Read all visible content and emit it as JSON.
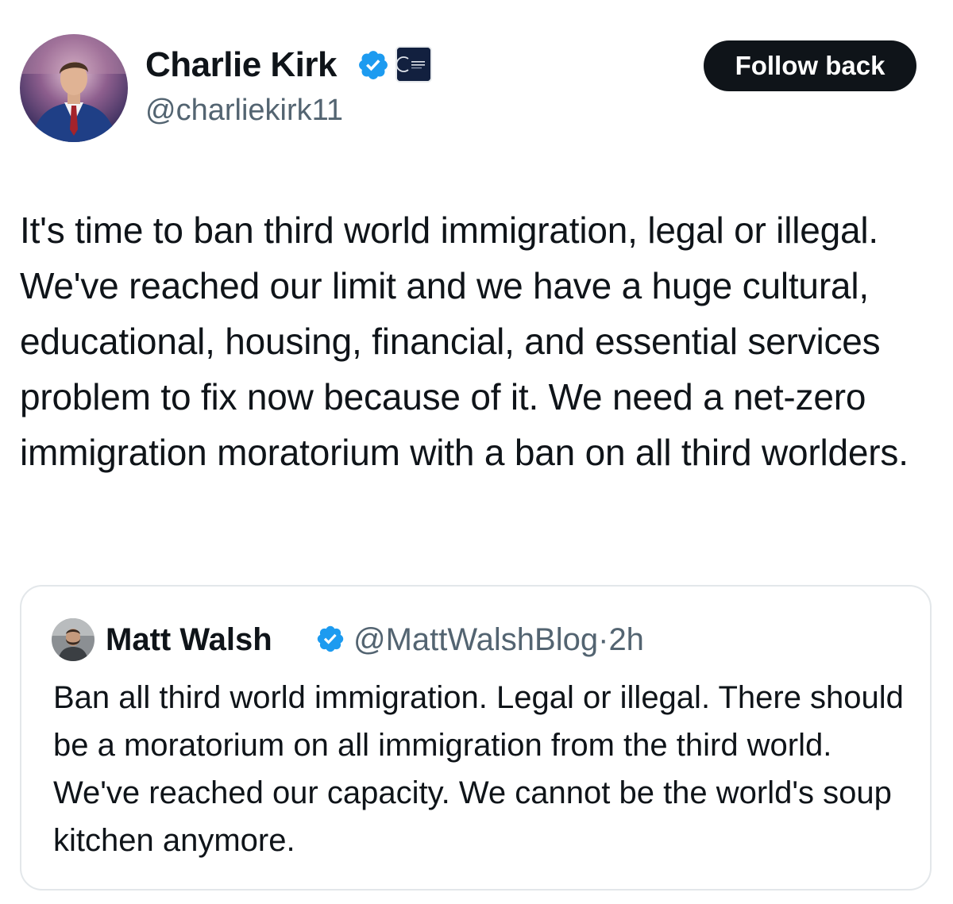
{
  "tweet": {
    "author": {
      "display_name": "Charlie Kirk",
      "handle": "@charliekirk11",
      "verified": true,
      "avatar": "profile-photo",
      "affiliation_badge": "turning-point-usa-logo"
    },
    "follow_button_label": "Follow back",
    "text": "It's time to ban third world immigration, legal or illegal. We've reached our limit and we have a huge cultural, educational, housing, financial, and essential services problem to fix now because of it. We need a net-zero immigration moratorium with a ban on all third worlders."
  },
  "quoted_tweet": {
    "author": {
      "display_name": "Matt Walsh",
      "handle": "@MattWalshBlog",
      "verified": true,
      "avatar": "profile-photo"
    },
    "separator": "·",
    "time": "2h",
    "text": "Ban all third world immigration. Legal or illegal. There should be a moratorium on all immigration from the third world. We've reached our capacity. We cannot be the world's soup kitchen anymore."
  },
  "colors": {
    "text_primary": "#0f1419",
    "text_secondary": "#536471",
    "verified_blue": "#1d9bf0",
    "button_bg": "#0f1419",
    "card_border": "#e3e7ea"
  }
}
